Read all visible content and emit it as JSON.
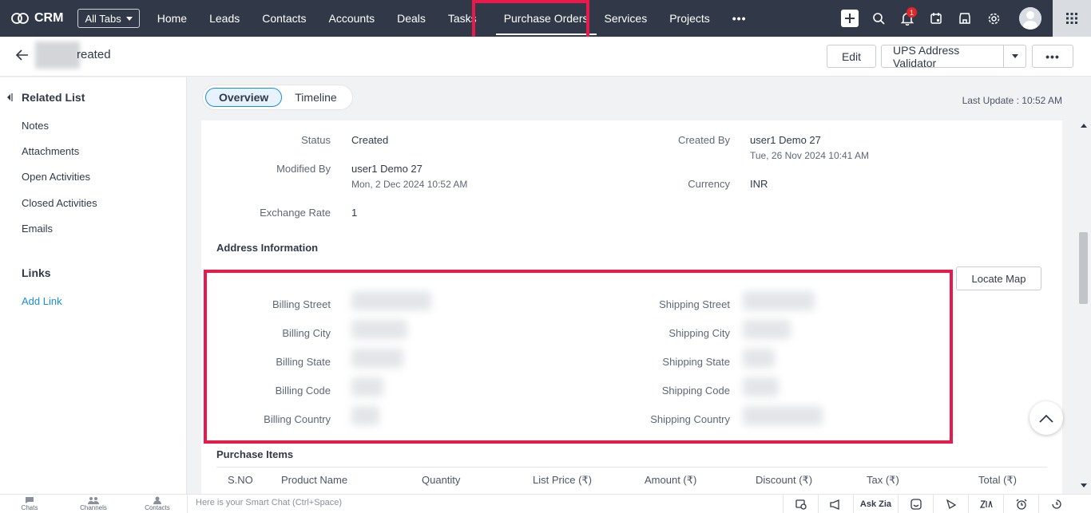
{
  "nav": {
    "logo_text": "CRM",
    "all_tabs_label": "All Tabs",
    "tabs": [
      "Home",
      "Leads",
      "Contacts",
      "Accounts",
      "Deals",
      "Tasks",
      "Purchase Orders",
      "Services",
      "Projects"
    ],
    "more_label": "•••",
    "notification_count": "1"
  },
  "record": {
    "title_suffix": "reated",
    "edit_label": "Edit",
    "ups_label": "UPS Address Validator",
    "more_label": "•••"
  },
  "sidebar": {
    "related_list_title": "Related List",
    "items": [
      "Notes",
      "Attachments",
      "Open Activities",
      "Closed Activities",
      "Emails"
    ],
    "links_title": "Links",
    "add_link_label": "Add Link"
  },
  "tabs": {
    "overview": "Overview",
    "timeline": "Timeline",
    "last_update": "Last Update : 10:52 AM"
  },
  "details": {
    "status_label": "Status",
    "status_value": "Created",
    "modified_by_label": "Modified By",
    "modified_by_value": "user1 Demo 27",
    "modified_by_time": "Mon, 2 Dec 2024 10:52 AM",
    "exchange_rate_label": "Exchange Rate",
    "exchange_rate_value": "1",
    "created_by_label": "Created By",
    "created_by_value": "user1 Demo 27",
    "created_by_time": "Tue, 26 Nov 2024 10:41 AM",
    "currency_label": "Currency",
    "currency_value": "INR"
  },
  "address": {
    "section_title": "Address Information",
    "locate_map_label": "Locate Map",
    "billing_labels": [
      "Billing Street",
      "Billing City",
      "Billing State",
      "Billing Code",
      "Billing Country"
    ],
    "shipping_labels": [
      "Shipping Street",
      "Shipping City",
      "Shipping State",
      "Shipping Code",
      "Shipping Country"
    ]
  },
  "items": {
    "section_title": "Purchase Items",
    "columns": [
      "S.NO",
      "Product Name",
      "Quantity",
      "List Price (₹)",
      "Amount (₹)",
      "Discount (₹)",
      "Tax (₹)",
      "Total (₹)"
    ]
  },
  "footer": {
    "chats": "Chats",
    "channels": "Channels",
    "contacts": "Contacts",
    "smart_chat_placeholder": "Here is your Smart Chat (Ctrl+Space)",
    "ask_zia": "Ask Zia"
  },
  "colors": {
    "nav_bg": "#313949",
    "highlight": "#e8194b",
    "link": "#1a8de2"
  }
}
